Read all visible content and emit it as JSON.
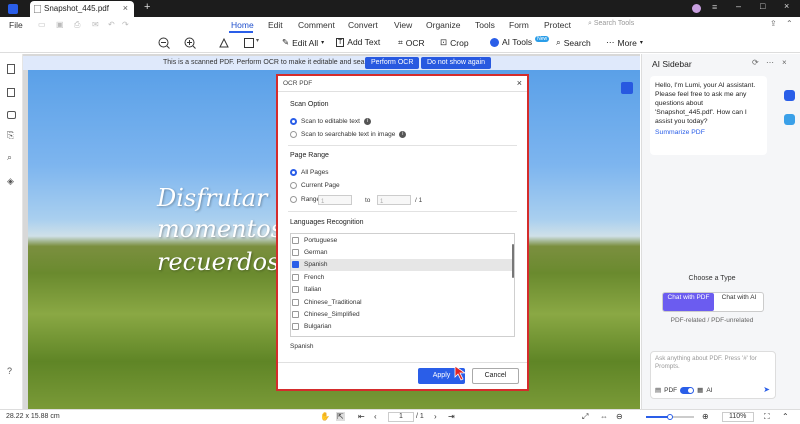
{
  "titlebar": {
    "tab_title": "Snapshot_445.pdf",
    "close": "×",
    "new_tab": "+"
  },
  "menubar": {
    "file": "File",
    "items": [
      "Home",
      "Edit",
      "Comment",
      "Convert",
      "View",
      "Organize",
      "Tools",
      "Form",
      "Protect"
    ],
    "active": "Home",
    "search_placeholder": "Search Tools"
  },
  "toolbar": {
    "edit_all": "Edit All",
    "add_text": "Add Text",
    "ocr": "OCR",
    "crop": "Crop",
    "ai_tools": "AI Tools",
    "ai_badge": "New",
    "search": "Search",
    "more": "More"
  },
  "banner": {
    "message": "This is a scanned PDF. Perform OCR to make it editable and searchable.",
    "perform_ocr": "Perform OCR",
    "dont_show": "Do not show again"
  },
  "document": {
    "lines": [
      "Disfrutar",
      "momentos",
      "recuerdos"
    ]
  },
  "ocr_dialog": {
    "title": "OCR PDF",
    "scan_option_label": "Scan Option",
    "scan_options": [
      "Scan to editable text",
      "Scan to searchable text in image"
    ],
    "selected_scan_option": "Scan to editable text",
    "page_range_label": "Page Range",
    "all_pages": "All Pages",
    "current_page": "Current Page",
    "range": "Range",
    "range_from": "1",
    "range_to_label": "to",
    "range_to": "1",
    "range_total": "/ 1",
    "languages_label": "Languages Recognition",
    "languages": [
      "Portuguese",
      "German",
      "Spanish",
      "French",
      "Italian",
      "Chinese_Traditional",
      "Chinese_Simplified",
      "Bulgarian"
    ],
    "checked_language": "Spanish",
    "selected_summary": "Spanish",
    "apply": "Apply",
    "cancel": "Cancel"
  },
  "sidebar": {
    "title": "AI Sidebar",
    "greeting": "Hello, I'm Lumi, your AI assistant. Please feel free to ask me any questions about 'Snapshot_445.pdf'. How can I assist you today?",
    "summarize": "Summarize PDF",
    "choose_type": "Choose a Type",
    "chat_pdf": "Chat with PDF",
    "chat_ai": "Chat with AI",
    "type_subtitle": "PDF-related / PDF-unrelated",
    "ask_placeholder": "Ask anything about PDF. Press '#' for Prompts.",
    "pdf_toggle": "PDF",
    "ai_toggle": "AI"
  },
  "statusbar": {
    "dimensions": "28.22 x 15.88 cm",
    "page_current": "1",
    "page_total": "/ 1",
    "zoom": "110%"
  },
  "colors": {
    "accent": "#2a5ee8",
    "dialog_border": "#d42c2c",
    "purple": "#6b5cf0"
  }
}
